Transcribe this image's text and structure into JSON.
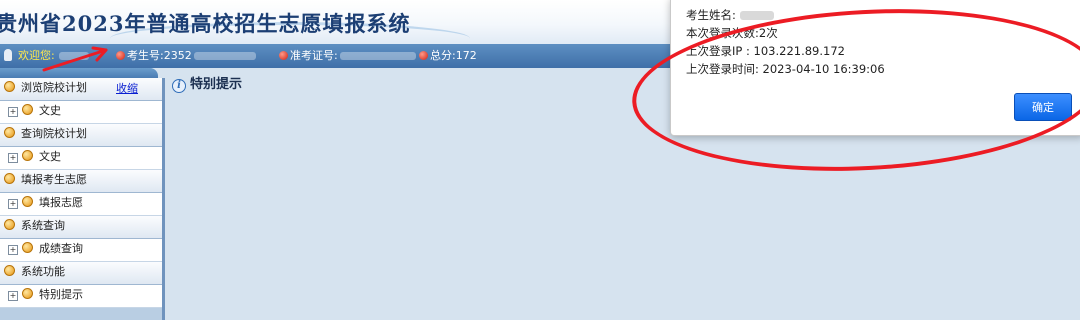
{
  "header": {
    "title": "贵州省2023年普通高校招生志愿填报系统"
  },
  "infobar": {
    "welcome_label": "欢迎您:",
    "exam_number_label": "考生号:",
    "exam_number_value_visible": "2352",
    "admission_ticket_label": "准考证号:",
    "total_score_label": "总分:",
    "total_score_value": "172"
  },
  "sidebar": {
    "collapse_label": "收缩",
    "sections": [
      {
        "label": "浏览院校计划",
        "sub": "文史"
      },
      {
        "label": "查询院校计划",
        "sub": "文史"
      },
      {
        "label": "填报考生志愿",
        "sub": "填报志愿"
      },
      {
        "label": "系统查询",
        "sub": "成绩查询"
      },
      {
        "label": "系统功能",
        "sub": "特别提示"
      }
    ]
  },
  "main": {
    "title": "特别提示"
  },
  "dialog": {
    "name_label": "考生姓名:",
    "login_count_label": "本次登录次数:",
    "login_count_value": "2次",
    "last_ip_label": "上次登录IP :",
    "last_ip_value": "103.221.89.172",
    "last_time_label": "上次登录时间:",
    "last_time_value": "2023-04-10 16:39:06",
    "ok_label": "确定"
  },
  "colors": {
    "annotation_red": "#ec1c24",
    "infobar_blue": "#4a7cb3",
    "ok_button_blue": "#0a66e6"
  }
}
